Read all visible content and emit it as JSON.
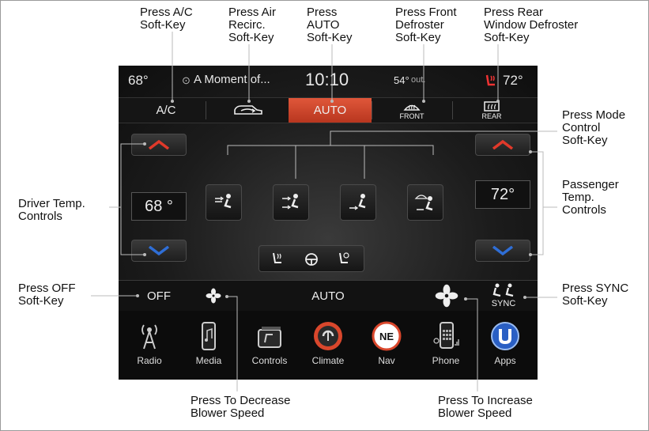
{
  "callouts": {
    "ac": "Press A/C\nSoft-Key",
    "recirc": "Press Air\nRecirc.\nSoft-Key",
    "auto": "Press\nAUTO\nSoft-Key",
    "front": "Press Front\nDefroster\nSoft-Key",
    "rear": "Press Rear\nWindow Defroster\nSoft-Key",
    "mode": "Press Mode\nControl\nSoft-Key",
    "driver": "Driver Temp.\nControls",
    "passenger": "Passenger\nTemp.\nControls",
    "off": "Press OFF\nSoft-Key",
    "sync": "Press SYNC\nSoft-Key",
    "decrease": "Press To Decrease\nBlower Speed",
    "increase": "Press To Increase\nBlower Speed"
  },
  "status": {
    "driver_temp": "68°",
    "media_text": "A Moment of...",
    "time": "10:10",
    "outside_temp": "54°",
    "outside_label": "out.",
    "passenger_temp": "72°"
  },
  "tabs": {
    "ac": "A/C",
    "auto": "AUTO",
    "front": "FRONT",
    "rear": "REAR"
  },
  "temps": {
    "driver": "68 °",
    "passenger": "72°"
  },
  "bottom": {
    "off": "OFF",
    "auto": "AUTO",
    "sync": "SYNC"
  },
  "nav": {
    "radio": "Radio",
    "media": "Media",
    "controls": "Controls",
    "climate": "Climate",
    "nav": "Nav",
    "nav_badge": "NE",
    "phone": "Phone",
    "apps": "Apps"
  },
  "colors": {
    "accent": "#d9472c",
    "arrow_up": "#e0392a",
    "arrow_down": "#2f6ed6"
  }
}
